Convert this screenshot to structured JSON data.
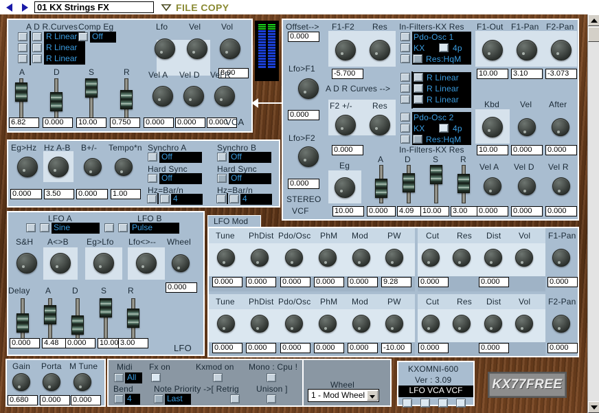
{
  "toolbar": {
    "prev_icon": "left-arrow-icon",
    "next_icon": "right-arrow-icon",
    "preset_name": "01 KX Strings FX",
    "menu_icon": "chevron-down-icon",
    "file_copy_label": "FILE COPY"
  },
  "vca": {
    "curves_label": "A D R.Curves",
    "comp_eg_label": "Comp Eg",
    "comp_eg_value": "Off",
    "curve_values": [
      "R Linear",
      "R Linear",
      "R Linear"
    ],
    "knob_labels": [
      "Lfo",
      "Vel",
      "Vol"
    ],
    "vol_value": "8.00",
    "env_labels": [
      "A",
      "D",
      "S",
      "R"
    ],
    "env_values": [
      "6.82",
      "0.000",
      "10.00",
      "0.750"
    ],
    "vel_labels": [
      "Vel A",
      "Vel D",
      "Vel R"
    ],
    "vel_values": [
      "0.000",
      "0.000",
      "0.000"
    ],
    "section_name": "VCA"
  },
  "vcf": {
    "offset_label": "Offset-->",
    "offset_value": "0.000",
    "lfo_f1_label": "Lfo>F1",
    "lfo_f1_value": "0.000",
    "lfo_f2_label": "Lfo>F2",
    "lfo_f2_value": "0.000",
    "stereo_label_1": "STEREO",
    "stereo_label_2": "VCF",
    "f1f2_label": "F1-F2",
    "f1f2_value": "-5.700",
    "res1_label": "Res",
    "f2pm_label": "F2 +/-",
    "f2pm_value": "0.000",
    "res2_label": "Res",
    "adr_curves_label": "A D R Curves -->",
    "infilters_label_top": "In-Filters-KX Res",
    "infilters_label_bottom": "In-Filters-KX Res",
    "osc1_label": "Pdo-Osc 1",
    "osc1_kx": "KX",
    "osc1_poles": "4p",
    "osc1_res": "Res:HqM",
    "curve_values": [
      "R Linear",
      "R Linear",
      "R Linear"
    ],
    "osc2_label": "Pdo-Osc 2",
    "osc2_kx": "KX",
    "osc2_poles": "4p",
    "osc2_res": "Res:HqM",
    "f1out_label": "F1-Out",
    "f1out_value": "10.00",
    "f1pan_label": "F1-Pan",
    "f1pan_value": "3.10",
    "f2pan_label": "F2-Pan",
    "f2pan_value": "-3.073",
    "kbd_label": "Kbd",
    "kbd_value": "10.00",
    "vel_label": "Vel",
    "vel_value": "0.000",
    "after_label": "After",
    "after_value": "0.000",
    "eg_label": "Eg",
    "eg_value": "10.00",
    "env_labels": [
      "A",
      "D",
      "S",
      "R"
    ],
    "env_values": [
      "0.000",
      "4.09",
      "10.00",
      "3.00"
    ],
    "vel_labels": [
      "Vel A",
      "Vel D",
      "Vel R"
    ],
    "vel_values": [
      "0.000",
      "0.000",
      "0.000"
    ]
  },
  "sync": {
    "eg_hz_label": "Eg>Hz",
    "eg_hz_value": "0.000",
    "hz_ab_label": "Hz A-B",
    "hz_ab_value": "3.50",
    "b_pm_label": "B+/-",
    "b_pm_value": "0.000",
    "tempo_label": "Tempo*n",
    "tempo_value": "1.00",
    "a": {
      "title": "Synchro A",
      "sync_value": "Off",
      "hard_sync_label": "Hard Sync",
      "hard_sync_value": "Off",
      "bar_label": "Hz=Bar/n",
      "bar_value": "4"
    },
    "b": {
      "title": "Synchro B",
      "sync_value": "Off",
      "hard_sync_label": "Hard Sync",
      "hard_sync_value": "Off",
      "bar_label": "Hz=Bar/n",
      "bar_value": "4"
    }
  },
  "lfo": {
    "a_title": "LFO A",
    "a_wave": "Sine",
    "b_title": "LFO B",
    "b_wave": "Pulse",
    "knob_labels": [
      "S&H",
      "A<>B",
      "Eg>Lfo",
      "Lfo<>--",
      "Wheel"
    ],
    "wheel_value": "0.000",
    "env_labels": [
      "Delay",
      "A",
      "D",
      "S",
      "R"
    ],
    "env_values": [
      "0.000",
      "4.48",
      "0.000",
      "10.00",
      "3.00"
    ],
    "section_name": "LFO"
  },
  "lfo_mod": {
    "tab_label": "LFO Mod",
    "row1": {
      "left_labels": [
        "Tune",
        "PhDist",
        "Pdo/Osc",
        "PhM",
        "Mod",
        "PW"
      ],
      "left_values": [
        "0.000",
        "0.000",
        "0.000",
        "0.000",
        "0.000",
        "9.28"
      ],
      "right_labels": [
        "Cut",
        "Res",
        "Dist",
        "Vol"
      ],
      "right_values": [
        "0.000",
        "",
        "0.000",
        ""
      ],
      "pan_label": "F1-Pan",
      "pan_value": "0.000"
    },
    "row2": {
      "left_labels": [
        "Tune",
        "PhDist",
        "Pdo/Osc",
        "PhM",
        "Mod",
        "PW"
      ],
      "left_values": [
        "0.000",
        "0.000",
        "0.000",
        "0.000",
        "0.000",
        "-10.00"
      ],
      "right_labels": [
        "Cut",
        "Res",
        "Dist",
        "Vol"
      ],
      "right_values": [
        "0.000",
        "",
        "0.000",
        ""
      ],
      "pan_label": "F2-Pan",
      "pan_value": "0.000"
    }
  },
  "bottom": {
    "gain_label": "Gain",
    "gain_value": "0.680",
    "porta_label": "Porta",
    "porta_value": "0.000",
    "mtune_label": "M Tune",
    "mtune_value": "0.000",
    "midi_label": "Midi",
    "midi_value": "All",
    "bend_label": "Bend",
    "bend_value": "4",
    "fx_on_label": "Fx on",
    "kxmod_on_label": "Kxmod on",
    "mono_cpu_label": "Mono : Cpu !",
    "note_priority_label": "Note Priority ->[ Retrig",
    "note_priority_value": "Last",
    "unison_label": "Unison ]",
    "wheel_label": "Wheel",
    "wheel_select_value": "1 - Mod Wheel",
    "info_name": "KXOMNI-600",
    "info_version": "Ver : 3.09",
    "info_modes": "LFO VCA VCF",
    "brand": "KX77FREE"
  },
  "colors": {
    "panel_blue": "#a9bdd0",
    "wood": "#6a3d1c",
    "lcd_text": "#3a9ce0",
    "filecopy": "#8a8a32"
  }
}
